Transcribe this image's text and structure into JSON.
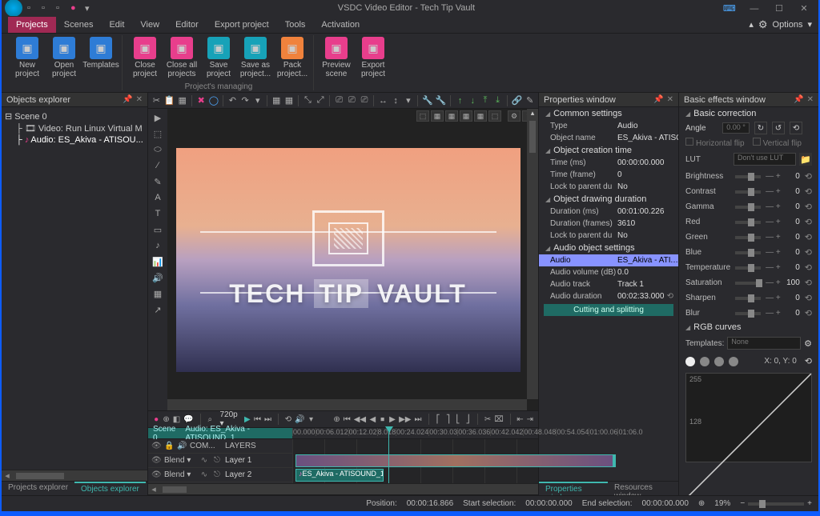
{
  "app_title": "VSDC Video Editor - Tech Tip Vault",
  "menubar": {
    "tabs": [
      "Projects",
      "Scenes",
      "Edit",
      "View",
      "Editor",
      "Export project",
      "Tools",
      "Activation"
    ],
    "active": 0,
    "options_label": "Options"
  },
  "ribbon": {
    "groups": [
      {
        "label": "",
        "buttons": [
          {
            "id": "new-project",
            "label": "New project",
            "iconcls": "blue"
          },
          {
            "id": "open-project",
            "label": "Open project",
            "iconcls": "blue"
          },
          {
            "id": "templates",
            "label": "Templates",
            "iconcls": "blue"
          }
        ]
      },
      {
        "label": "Project's managing",
        "buttons": [
          {
            "id": "close-project",
            "label": "Close project",
            "iconcls": "pink"
          },
          {
            "id": "close-all",
            "label": "Close all projects",
            "iconcls": "pink"
          },
          {
            "id": "save-project",
            "label": "Save project",
            "iconcls": "teal"
          },
          {
            "id": "save-as",
            "label": "Save as project...",
            "iconcls": "teal"
          },
          {
            "id": "pack-project",
            "label": "Pack project...",
            "iconcls": "orange"
          }
        ]
      },
      {
        "label": "",
        "buttons": [
          {
            "id": "preview-scene",
            "label": "Preview scene",
            "iconcls": "pink"
          },
          {
            "id": "export-project",
            "label": "Export project",
            "iconcls": "pink"
          }
        ]
      }
    ]
  },
  "objects_explorer": {
    "title": "Objects explorer",
    "tree": [
      {
        "label": "Scene 0",
        "level": 0
      },
      {
        "label": "Video: Run Linux Virtual M",
        "level": 1,
        "icon": "film"
      },
      {
        "label": "Audio: ES_Akiva - ATISOU...",
        "level": 1,
        "icon": "note",
        "selected": true
      }
    ],
    "tabs": [
      "Projects explorer",
      "Objects explorer"
    ],
    "active_tab": 1
  },
  "preview_brand_parts": [
    "TECH",
    "TIP",
    "VAULT"
  ],
  "playbar": {
    "resolution": "720p"
  },
  "timeline": {
    "header_left": [
      "Scene 0",
      "Audio: ES_Akiva - ATISOUND_1"
    ],
    "ruler": [
      "00.000",
      "00:06.012",
      "00:12.02",
      "8.018",
      "00:24.024",
      "00:30.03",
      "00:36.036",
      "00:42.042",
      "00:48.048",
      "00:54.054",
      "01:00.06",
      "01:06.0"
    ],
    "left_header": {
      "com": "COM...",
      "layers": "LAYERS"
    },
    "rows": [
      {
        "blend": "Blend",
        "name": "Layer 1"
      },
      {
        "blend": "Blend",
        "name": "Layer 2"
      }
    ],
    "audio_clip": "ES_Akiva - ATISOUND_1"
  },
  "properties": {
    "title": "Properties window",
    "sections": [
      {
        "name": "Common settings",
        "rows": [
          {
            "k": "Type",
            "v": "Audio",
            "hdr": true
          },
          {
            "k": "Object name",
            "v": "ES_Akiva - ATISOUND_"
          }
        ]
      },
      {
        "name": "Object creation time",
        "rows": [
          {
            "k": "Time (ms)",
            "v": "00:00:00.000"
          },
          {
            "k": "Time (frame)",
            "v": "0"
          },
          {
            "k": "Lock to parent du",
            "v": "No"
          }
        ]
      },
      {
        "name": "Object drawing duration",
        "rows": [
          {
            "k": "Duration (ms)",
            "v": "00:01:00.226"
          },
          {
            "k": "Duration (frames)",
            "v": "3610"
          },
          {
            "k": "Lock to parent du",
            "v": "No"
          }
        ]
      },
      {
        "name": "Audio object settings",
        "rows": [
          {
            "k": "Audio",
            "v": "ES_Akiva - ATISOUN",
            "sel": true
          },
          {
            "k": "Audio volume (dB)",
            "v": "0.0"
          },
          {
            "k": "Audio track",
            "v": "Track 1"
          },
          {
            "k": "Audio duration",
            "v": "00:02:33.000",
            "hdr": true
          }
        ]
      }
    ],
    "button": "Cutting and splitting",
    "bottom_tabs": [
      "Properties window",
      "Resources window"
    ],
    "active_bottom": 0
  },
  "effects": {
    "title": "Basic effects window",
    "section1": "Basic correction",
    "angle_label": "Angle",
    "angle_value": "0.00 °",
    "hflip": "Horizontal flip",
    "vflip": "Vertical flip",
    "lut_label": "LUT",
    "lut_value": "Don't use LUT",
    "sliders": [
      {
        "name": "Brightness",
        "val": "0",
        "pos": 50
      },
      {
        "name": "Contrast",
        "val": "0",
        "pos": 50
      },
      {
        "name": "Gamma",
        "val": "0",
        "pos": 50
      },
      {
        "name": "Red",
        "val": "0",
        "pos": 50
      },
      {
        "name": "Green",
        "val": "0",
        "pos": 50
      },
      {
        "name": "Blue",
        "val": "0",
        "pos": 50
      },
      {
        "name": "Temperature",
        "val": "0",
        "pos": 50
      },
      {
        "name": "Saturation",
        "val": "100",
        "pos": 80
      },
      {
        "name": "Sharpen",
        "val": "0",
        "pos": 50
      },
      {
        "name": "Blur",
        "val": "0",
        "pos": 50
      }
    ],
    "section2": "RGB curves",
    "templates_label": "Templates:",
    "templates_value": "None",
    "xy_label": "X: 0, Y: 0",
    "curve_255": "255",
    "curve_128": "128"
  },
  "status": {
    "position_label": "Position:",
    "position_val": "00:00:16.866",
    "start_label": "Start selection:",
    "start_val": "00:00:00.000",
    "end_label": "End selection:",
    "end_val": "00:00:00.000",
    "zoom": "19%"
  }
}
